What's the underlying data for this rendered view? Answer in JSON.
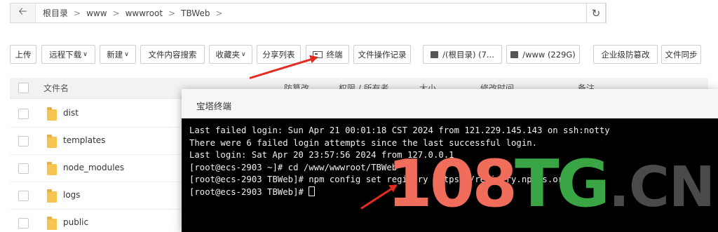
{
  "address_bar": {
    "back_icon": "arrow-left-icon",
    "crumbs": [
      "根目录",
      "www",
      "wwwroot",
      "TBWeb"
    ],
    "refresh_icon": "refresh-icon"
  },
  "toolbar": {
    "upload": "上传",
    "remote_download": "远程下载",
    "new": "新建",
    "content_search": "文件内容搜索",
    "favorites": "收藏夹",
    "share_list": "分享列表",
    "terminal": "终端",
    "operation_log": "文件操作记录",
    "disk_root": "/(根目录) (7...",
    "disk_www": "/www (229G)",
    "tamper_proof": "企业级防篡改",
    "file_sync": "文件同步"
  },
  "table": {
    "col_name": "文件名",
    "col_tamper": "防篡改",
    "col_perm": "权限 / 所有者",
    "col_size": "大小",
    "col_mtime": "修改时间",
    "col_note": "备注",
    "rows": [
      {
        "name": "dist"
      },
      {
        "name": "templates"
      },
      {
        "name": "node_modules"
      },
      {
        "name": "logs"
      },
      {
        "name": "public"
      }
    ]
  },
  "dialog": {
    "title": "宝塔终端",
    "lines": [
      "Last failed login: Sun Apr 21 00:01:18 CST 2024 from 121.229.145.143 on ssh:notty",
      "There were 6 failed login attempts since the last successful login.",
      "Last login: Sat Apr 20 23:57:56 2024 from 127.0.0.1",
      "[root@ecs-2903 ~]# cd /www/wwwroot/TBWeb",
      "[root@ecs-2903 TBWeb]# npm config set registry https://registry.npmjs.org/",
      "[root@ecs-2903 TBWeb]# "
    ]
  },
  "watermark": {
    "digits": "108",
    "letters": "TG",
    "suffix": ".CN"
  },
  "colors": {
    "arrow": "#e52b1f",
    "terminal_bg": "#000000",
    "folder": "#f5c451",
    "watermark_red": "#f06d5b",
    "watermark_green": "#3aa544"
  }
}
